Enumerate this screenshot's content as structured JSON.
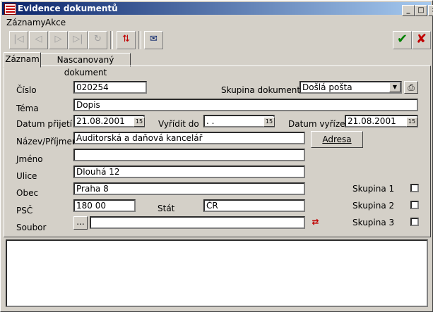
{
  "window": {
    "title": "Evidence dokumentů"
  },
  "menu": {
    "items": [
      "Záznamy",
      "Akce"
    ]
  },
  "tabs": [
    "Záznam",
    "Nascanovaný dokument"
  ],
  "form": {
    "cislo_label": "Číslo",
    "cislo_value": "020254",
    "skupina_dokumentu_label": "Skupina dokumentů",
    "skupina_dokumentu_value": "Došlá pošta",
    "tema_label": "Téma",
    "tema_value": "Dopis",
    "datum_prijeti_label": "Datum přijetí",
    "datum_prijeti_value": "21.08.2001",
    "vyridit_do_label": "Vyřídit do",
    "vyridit_do_value": " . .",
    "datum_vyrizeni_label": "Datum vyřízení",
    "datum_vyrizeni_value": "21.08.2001",
    "nazev_label": "Název/Příjmení",
    "nazev_value": "Auditorská a daňová kancelář",
    "adresa_button": "Adresa",
    "jmeno_label": "Jméno",
    "jmeno_value": "",
    "ulice_label": "Ulice",
    "ulice_value": "Dlouhá 12",
    "obec_label": "Obec",
    "obec_value": "Praha 8",
    "psc_label": "PSČ",
    "psc_value": "180 00",
    "stat_label": "Stát",
    "stat_value": "ČR",
    "soubor_label": "Soubor",
    "soubor_value": "",
    "browse_button": "...",
    "skupina1_label": "Skupina 1",
    "skupina2_label": "Skupina 2",
    "skupina3_label": "Skupina 3",
    "cal_icon_text": "15"
  },
  "titlebar_buttons": {
    "minimize": "_",
    "maximize": "□",
    "close": "×"
  }
}
